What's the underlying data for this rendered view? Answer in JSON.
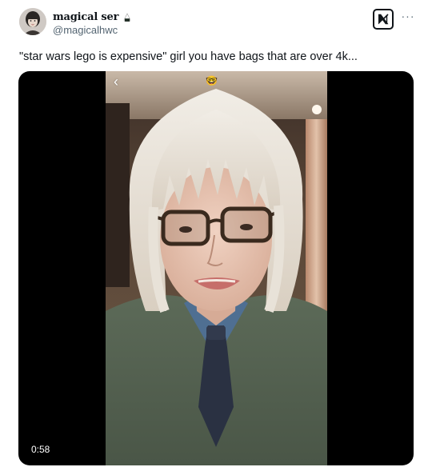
{
  "author": {
    "display_name": "magical ser",
    "handle": "@magicalhwc",
    "avatar_icon": "profile-photo",
    "badge_icon": "rice-ball-emoji"
  },
  "header": {
    "logo_icon": "x-logo-icon",
    "more_icon": "more-options-icon",
    "more_label": "···"
  },
  "tweet": {
    "text": "\"star wars lego is expensive\" girl you have bags that are over 4k..."
  },
  "media": {
    "type": "video",
    "duration": "0:58",
    "back_glyph": "‹",
    "sticker_glyph": "🤓"
  },
  "colors": {
    "text_primary": "#0f1419",
    "text_secondary": "#536471",
    "media_background": "#000000"
  }
}
